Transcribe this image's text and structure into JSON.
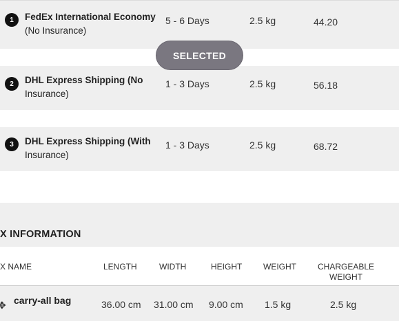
{
  "shipping_options": [
    {
      "index": "1",
      "service_line1": "FedEx International Economy",
      "service_line2": "(No Insurance)",
      "days": "5 - 6 Days",
      "weight": "2.5 kg",
      "price": "44.20"
    },
    {
      "index": "2",
      "service_line1": "DHL Express Shipping (No",
      "service_line2": "Insurance)",
      "days": "1 - 3 Days",
      "weight": "2.5 kg",
      "price": "56.18"
    },
    {
      "index": "3",
      "service_line1": "DHL Express Shipping (With",
      "service_line2": "Insurance)",
      "days": "1 - 3 Days",
      "weight": "2.5 kg",
      "price": "68.72"
    }
  ],
  "selected_label": "SELECTED",
  "box_info": {
    "title": "X INFORMATION",
    "headers": {
      "name": "X NAME",
      "length": "LENGTH",
      "width": "WIDTH",
      "height": "HEIGHT",
      "weight": "WEIGHT",
      "chargeable_line1": "CHARGEABLE",
      "chargeable_line2": "WEIGHT"
    },
    "rows": [
      {
        "name": "carry-all bag",
        "length": "36.00 cm",
        "width": "31.00 cm",
        "height": "9.00 cm",
        "weight": "1.5 kg",
        "chargeable": "2.5 kg"
      }
    ]
  },
  "icons": {
    "row_icon": "dropbox-icon"
  }
}
